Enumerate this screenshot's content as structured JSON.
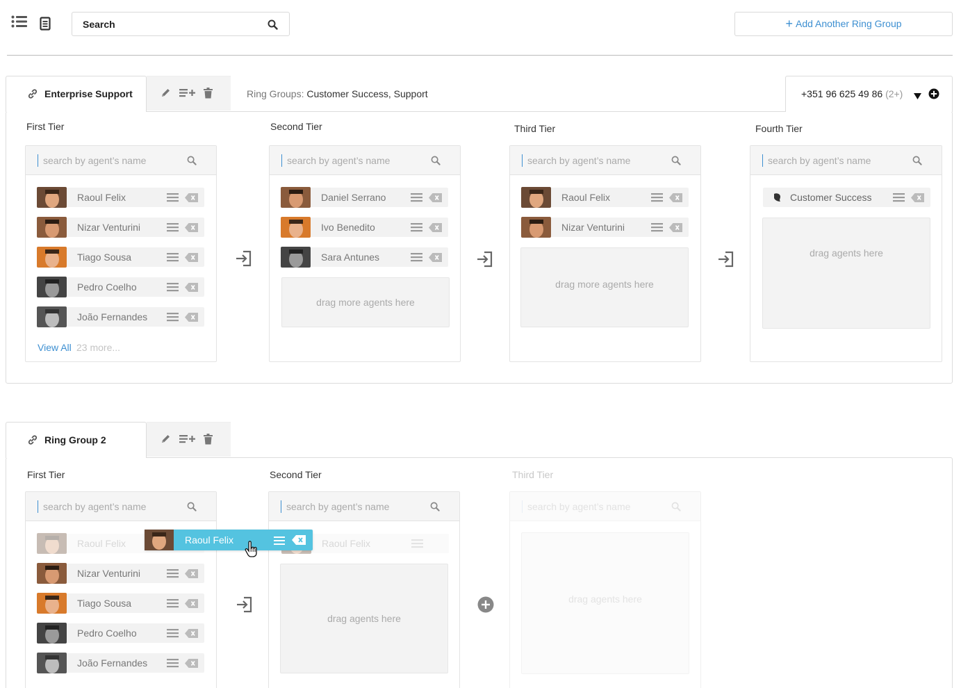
{
  "toolbar": {
    "search_value": "Search",
    "add_button_label": "Add Another Ring Group"
  },
  "groups": [
    {
      "name": "Enterprise Support",
      "ring_groups_label": "Ring Groups:",
      "ring_groups_value": "Customer Success, Support",
      "phone": "+351 96 625 49 86",
      "phone_more": "(2+)",
      "tiers": [
        {
          "label": "First Tier",
          "search_placeholder": "search by agent’s name",
          "agents": [
            "Raoul Felix",
            "Nizar Venturini",
            "Tiago Sousa",
            "Pedro Coelho",
            "João Fernandes"
          ],
          "view_all": "View All",
          "more": "23 more..."
        },
        {
          "label": "Second Tier",
          "search_placeholder": "search by agent’s name",
          "agents": [
            "Daniel Serrano",
            "Ivo Benedito",
            "Sara Antunes"
          ],
          "dropzone": "drag more agents here"
        },
        {
          "label": "Third Tier",
          "search_placeholder": "search by agent’s name",
          "agents": [
            "Raoul Felix",
            "Nizar Venturini"
          ],
          "dropzone": "drag more agents here"
        },
        {
          "label": "Fourth Tier",
          "search_placeholder": "search by agent’s name",
          "agents": [
            "Customer Success"
          ],
          "dropzone": "drag agents here"
        }
      ]
    },
    {
      "name": "Ring Group 2",
      "tiers": [
        {
          "label": "First Tier",
          "search_placeholder": "search by agent’s name",
          "agents": [
            "Raoul Felix",
            "Nizar Venturini",
            "Tiago Sousa",
            "Pedro Coelho",
            "João Fernandes"
          ]
        },
        {
          "label": "Second Tier",
          "search_placeholder": "search by agent’s name",
          "agents": [
            "Raoul Felix"
          ],
          "dropzone": "drag agents here"
        },
        {
          "label": "Third Tier",
          "search_placeholder": "search by agent’s name",
          "dropzone": "drag agents here"
        }
      ],
      "dragging_agent": "Raoul Felix"
    }
  ],
  "colors": {
    "accent": "#3d8fd1",
    "drag": "#54c3e0"
  }
}
